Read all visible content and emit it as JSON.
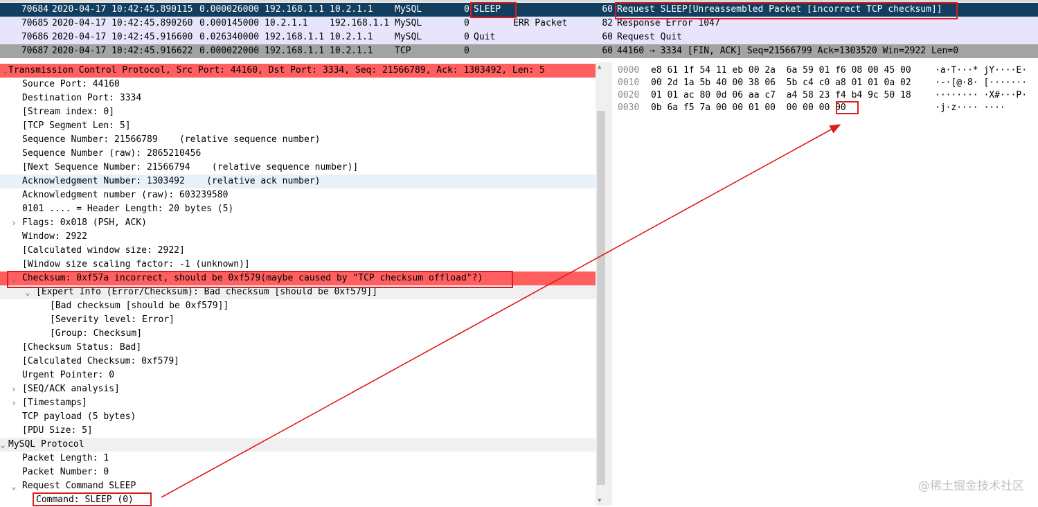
{
  "packet_list": {
    "rows": [
      {
        "no": "70684",
        "time": "2020-04-17 10:42:45.890115",
        "delta": "0.000026000",
        "src": "192.168.1.1",
        "dst": "10.2.1.1",
        "proto": "MySQL",
        "f1": "0",
        "f2": "SLEEP",
        "f3": "",
        "len": "60",
        "info": "Request SLEEP[Unreassembled Packet [incorrect TCP checksum]]"
      },
      {
        "no": "70685",
        "time": "2020-04-17 10:42:45.890260",
        "delta": "0.000145000",
        "src": "10.2.1.1",
        "dst": "192.168.1.1",
        "proto": "MySQL",
        "f1": "0",
        "f2": "",
        "f3": "ERR Packet",
        "len": "82",
        "info": "Response Error 1047"
      },
      {
        "no": "70686",
        "time": "2020-04-17 10:42:45.916600",
        "delta": "0.026340000",
        "src": "192.168.1.1",
        "dst": "10.2.1.1",
        "proto": "MySQL",
        "f1": "0",
        "f2": "Quit",
        "f3": "",
        "len": "60",
        "info": "Request Quit"
      },
      {
        "no": "70687",
        "time": "2020-04-17 10:42:45.916622",
        "delta": "0.000022000",
        "src": "192.168.1.1",
        "dst": "10.2.1.1",
        "proto": "TCP",
        "f1": "0",
        "f2": "",
        "f3": "",
        "len": "60",
        "info": "44160 → 3334 [FIN, ACK] Seq=21566799 Ack=1303520 Win=2922 Len=0"
      }
    ]
  },
  "detail": {
    "lines": [
      {
        "text": "Transmission Control Protocol, Src Port: 44160, Dst Port: 3334, Seq: 21566789, Ack: 1303492, Len: 5",
        "arrow": "⌄"
      },
      {
        "text": "Source Port: 44160",
        "arrow": ""
      },
      {
        "text": "Destination Port: 3334",
        "arrow": ""
      },
      {
        "text": "[Stream index: 0]",
        "arrow": ""
      },
      {
        "text": "[TCP Segment Len: 5]",
        "arrow": ""
      },
      {
        "text": "Sequence Number: 21566789    (relative sequence number)",
        "arrow": ""
      },
      {
        "text": "Sequence Number (raw): 2865210456",
        "arrow": ""
      },
      {
        "text": "[Next Sequence Number: 21566794    (relative sequence number)]",
        "arrow": ""
      },
      {
        "text": "Acknowledgment Number: 1303492    (relative ack number)",
        "arrow": ""
      },
      {
        "text": "Acknowledgment number (raw): 603239580",
        "arrow": ""
      },
      {
        "text": "0101 .... = Header Length: 20 bytes (5)",
        "arrow": ""
      },
      {
        "text": "Flags: 0x018 (PSH, ACK)",
        "arrow": "›"
      },
      {
        "text": "Window: 2922",
        "arrow": ""
      },
      {
        "text": "[Calculated window size: 2922]",
        "arrow": ""
      },
      {
        "text": "[Window size scaling factor: -1 (unknown)]",
        "arrow": ""
      },
      {
        "text": "Checksum: 0xf57a incorrect, should be 0xf579(maybe caused by \"TCP checksum offload\"?)",
        "arrow": "⌄"
      },
      {
        "text": "[Expert Info (Error/Checksum): Bad checksum [should be 0xf579]]",
        "arrow": "⌄"
      },
      {
        "text": "[Bad checksum [should be 0xf579]]",
        "arrow": ""
      },
      {
        "text": "[Severity level: Error]",
        "arrow": ""
      },
      {
        "text": "[Group: Checksum]",
        "arrow": ""
      },
      {
        "text": "[Checksum Status: Bad]",
        "arrow": ""
      },
      {
        "text": "[Calculated Checksum: 0xf579]",
        "arrow": ""
      },
      {
        "text": "Urgent Pointer: 0",
        "arrow": ""
      },
      {
        "text": "[SEQ/ACK analysis]",
        "arrow": "›"
      },
      {
        "text": "[Timestamps]",
        "arrow": "›"
      },
      {
        "text": "TCP payload (5 bytes)",
        "arrow": ""
      },
      {
        "text": "[PDU Size: 5]",
        "arrow": ""
      },
      {
        "text": "MySQL Protocol",
        "arrow": "⌄"
      },
      {
        "text": "Packet Length: 1",
        "arrow": ""
      },
      {
        "text": "Packet Number: 0",
        "arrow": ""
      },
      {
        "text": "Request Command SLEEP",
        "arrow": "⌄"
      },
      {
        "text": "Command: SLEEP (0)",
        "arrow": ""
      }
    ]
  },
  "hex": {
    "rows": [
      {
        "offset": "0000",
        "bytes": "e8 61 1f 54 11 eb 00 2a  6a 59 01 f6 08 00 45 00",
        "ascii": "·a·T···* jY····E·"
      },
      {
        "offset": "0010",
        "bytes": "00 2d 1a 5b 40 00 38 06  5b c4 c0 a8 01 01 0a 02",
        "ascii": "·-·[@·8· [·······"
      },
      {
        "offset": "0020",
        "bytes": "01 01 ac 80 0d 06 aa c7  a4 58 23 f4 b4 9c 50 18",
        "ascii": "········ ·X#···P·"
      },
      {
        "offset": "0030",
        "bytes": "0b 6a f5 7a 00 00 01 00  00 00 00 00",
        "ascii": "·j·z···· ····"
      }
    ]
  },
  "watermark": "@稀土掘金技术社区",
  "colors": {
    "selected_row": "#123e5f",
    "error_highlight": "#ff5f5f",
    "annotation_red": "#e01b1b"
  }
}
